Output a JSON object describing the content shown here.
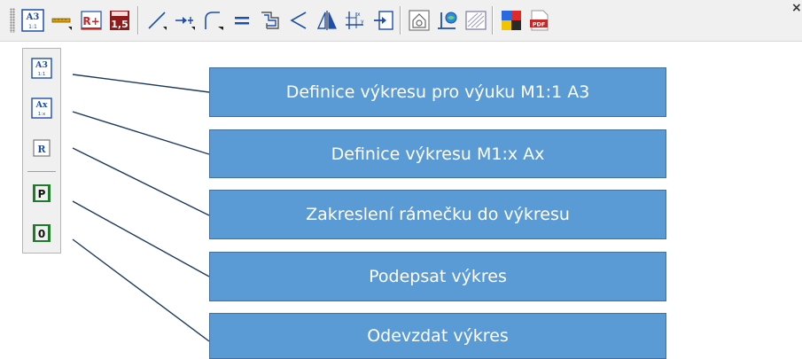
{
  "toolbar": {
    "buttons": [
      {
        "icon": "a3-drawing-icon",
        "text_top": "A3",
        "text_bottom": "1:1"
      },
      {
        "icon": "dimension-line-icon"
      },
      {
        "icon": "r-plus-icon",
        "text": "R+"
      },
      {
        "icon": "scale-15-icon",
        "text": "1,5"
      },
      {
        "icon": "line-icon"
      },
      {
        "icon": "arrow-to-point-icon"
      },
      {
        "icon": "fillet-arc-icon"
      },
      {
        "icon": "equal-sign-icon"
      },
      {
        "icon": "offset-shape-icon"
      },
      {
        "icon": "angle-icon"
      },
      {
        "icon": "mirror-icon"
      },
      {
        "icon": "coordinate-xy-icon"
      },
      {
        "icon": "insert-block-icon"
      },
      {
        "icon": "house-view-icon"
      },
      {
        "icon": "pin-globe-icon"
      },
      {
        "icon": "hatch-icon"
      },
      {
        "icon": "color-palette-icon"
      },
      {
        "icon": "pdf-export-icon",
        "text": "PDF"
      }
    ],
    "close_label": "×"
  },
  "flyout": {
    "items": [
      {
        "icon": "a3-drawing-icon",
        "text_top": "A3",
        "text_bottom": "1:1"
      },
      {
        "icon": "ax-drawing-icon",
        "text_top": "Ax",
        "text_bottom": "1:x"
      },
      {
        "icon": "frame-r-icon",
        "text": "R"
      },
      {
        "icon": "sign-p-icon",
        "text": "P"
      },
      {
        "icon": "submit-0-icon",
        "text": "0"
      }
    ]
  },
  "callouts": [
    "Definice výkresu pro výuku M1:1 A3",
    "Definice výkresu M1:x Ax",
    "Zakreslení rámečku do výkresu",
    "Podepsat výkres",
    "Odevzdat výkres"
  ],
  "colors": {
    "callout_fill": "#5b9bd5",
    "callout_border": "#41719c",
    "leader_line": "#1f3a5f",
    "icon_blue": "#1f4fa8",
    "icon_red": "#c62828"
  }
}
